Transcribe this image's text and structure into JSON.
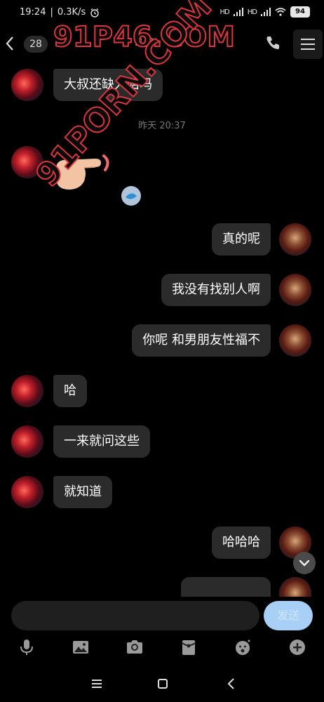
{
  "status_bar": {
    "time": "19:24",
    "net_speed": "0.3K/s",
    "signal1": "HD",
    "signal2": "HD",
    "battery": "94"
  },
  "header": {
    "unread_count": "28",
    "chat_name": "♪ ♫ ♪"
  },
  "watermarks": [
    "91P46.COM",
    "91PORN.COM"
  ],
  "timestamp": "昨天 20:37",
  "messages": [
    {
      "side": "other",
      "text": "大叔还缺人陪吗"
    },
    {
      "side": "self",
      "text": "真的呢"
    },
    {
      "side": "self",
      "text": "我没有找别人啊"
    },
    {
      "side": "self",
      "text": "你呢 和男朋友性福不"
    },
    {
      "side": "other",
      "text": "哈"
    },
    {
      "side": "other",
      "text": "一来就问这些"
    },
    {
      "side": "other",
      "text": "就知道"
    },
    {
      "side": "self",
      "text": "哈哈哈"
    }
  ],
  "input": {
    "placeholder": "",
    "send_label": "发送"
  },
  "toolbar_icons": [
    "mic-icon",
    "image-icon",
    "camera-icon",
    "red-packet-icon",
    "emoji-icon",
    "plus-icon"
  ],
  "colors": {
    "bubble": "#2b2b2b",
    "send_button": "#a8cff5",
    "watermark_stroke": "#d9363e"
  }
}
